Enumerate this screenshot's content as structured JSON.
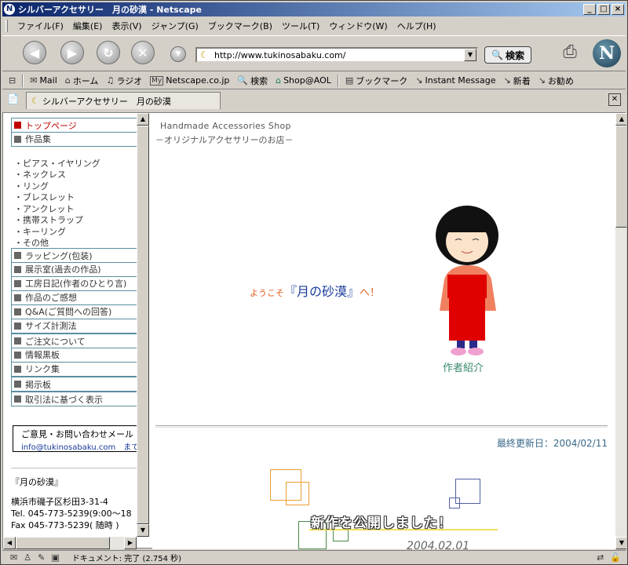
{
  "window": {
    "title": "シルバーアクセサリー　月の砂漠 - Netscape"
  },
  "menu": [
    "ファイル(F)",
    "編集(E)",
    "表示(V)",
    "ジャンプ(G)",
    "ブックマーク(B)",
    "ツール(T)",
    "ウィンドウ(W)",
    "ヘルプ(H)"
  ],
  "nav": {
    "url": "http://www.tukinosabaku.com/",
    "search_label": "検索"
  },
  "personal_toolbar": [
    {
      "icon": "mail-icon",
      "label": "Mail"
    },
    {
      "icon": "home-icon",
      "label": "ホーム"
    },
    {
      "icon": "radio-icon",
      "label": "ラジオ"
    },
    {
      "icon": "my-icon",
      "label": "Netscape.co.jp"
    },
    {
      "icon": "search-icon",
      "label": "検索"
    },
    {
      "icon": "shop-icon",
      "label": "Shop@AOL"
    },
    {
      "icon": "bookmark-icon",
      "label": "ブックマーク"
    },
    {
      "icon": "link-icon",
      "label": "Instant Message"
    },
    {
      "icon": "link-icon",
      "label": "新着"
    },
    {
      "icon": "link-icon",
      "label": "お勧め"
    }
  ],
  "tab": {
    "title": "シルバーアクセサリー　月の砂漠"
  },
  "left_nav": {
    "top_items": [
      "トップページ",
      "作品集"
    ],
    "sub_items": [
      "・ピアス・イヤリング",
      "・ネックレス",
      "・リング",
      "・ブレスレット",
      "・アンクレット",
      "・携帯ストラップ",
      "・キーリング",
      "・その他"
    ],
    "items": [
      "ラッピング(包装)",
      "展示室(過去の作品)",
      "工房日記(作者のひとり言)",
      "作品のご感想",
      "Q&A(ご質問への回答)",
      "サイズ計測法",
      "ご注文について",
      "情報黒板",
      "リンク集",
      "掲示板",
      "取引法に基づく表示"
    ],
    "contact_title": "ご意見・お問い合わせメール",
    "contact_email": "info@tukinosabaku.com　まで",
    "address": [
      "『月の砂漠』",
      "横浜市磯子区杉田3-31-4",
      "Tel. 045-773-5239(9:00～18",
      "Fax 045-773-5239( 随時 )"
    ]
  },
  "main": {
    "site_en": "Handmade Accessories Shop",
    "site_jp": "－オリジナルアクセサリーのお店－",
    "welcome_pre": "ようこそ",
    "welcome_name": "『月の砂漠』",
    "welcome_post": "へ！",
    "author_link": "作者紹介",
    "updated": "最終更新日：2004/02/11",
    "news": "新作を公開しました！",
    "news_date": "2004.02.01"
  },
  "status": {
    "text": "ドキュメント: 完了 (2.754 秒)"
  }
}
